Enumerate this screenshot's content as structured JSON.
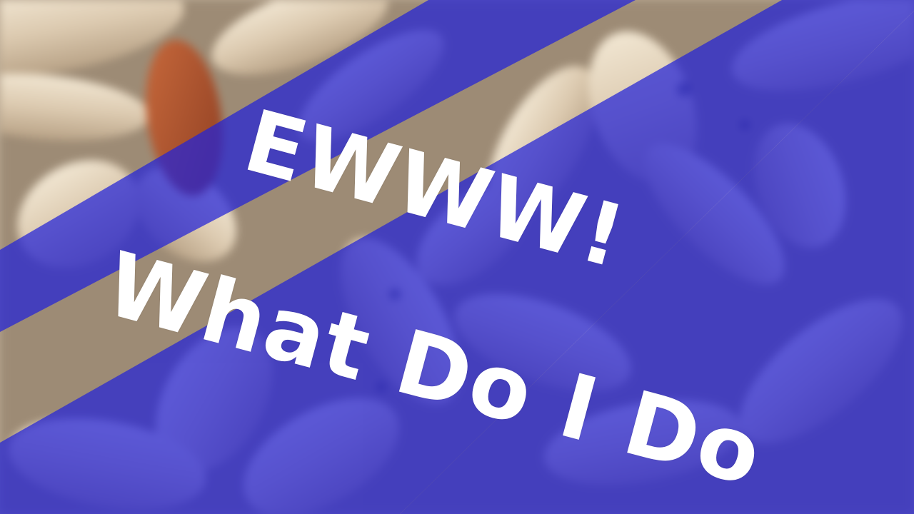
{
  "headline": {
    "line1": "EWWW!",
    "line2": "What Do I Do"
  },
  "colors": {
    "band": "#2323d8",
    "text": "#ffffff",
    "larva": "#e2d4bd",
    "pupa": "#b1532f"
  },
  "image": {
    "subject": "maggots-larvae-close-up-icon"
  }
}
